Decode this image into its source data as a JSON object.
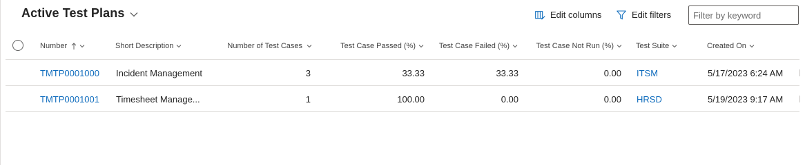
{
  "header": {
    "title": "Active Test Plans",
    "edit_columns_label": "Edit columns",
    "edit_filters_label": "Edit filters",
    "filter_placeholder": "Filter by keyword"
  },
  "columns": [
    {
      "label": "Number",
      "sort": "ascending"
    },
    {
      "label": "Short Description"
    },
    {
      "label": "Number of Test Cases"
    },
    {
      "label": "Test Case Passed (%)"
    },
    {
      "label": "Test Case Failed (%)"
    },
    {
      "label": "Test Case Not Run (%)"
    },
    {
      "label": "Test Suite"
    },
    {
      "label": "Created On"
    }
  ],
  "rows": [
    {
      "number": "TMTP0001000",
      "short_description": "Incident Management",
      "test_cases": "3",
      "passed": "33.33",
      "failed": "33.33",
      "not_run": "0.00",
      "suite": "ITSM",
      "created_on": "5/17/2023 6:24 AM"
    },
    {
      "number": "TMTP0001001",
      "short_description": "Timesheet Manage...",
      "test_cases": "1",
      "passed": "100.00",
      "failed": "0.00",
      "not_run": "0.00",
      "suite": "HRSD",
      "created_on": "5/19/2023 9:17 AM"
    }
  ],
  "colors": {
    "link": "#0f6cbd",
    "text": "#242424",
    "border": "#e1dfdd"
  },
  "icons": [
    "chevron-down-icon",
    "edit-columns-icon",
    "filter-icon",
    "sort-ascending-icon"
  ]
}
